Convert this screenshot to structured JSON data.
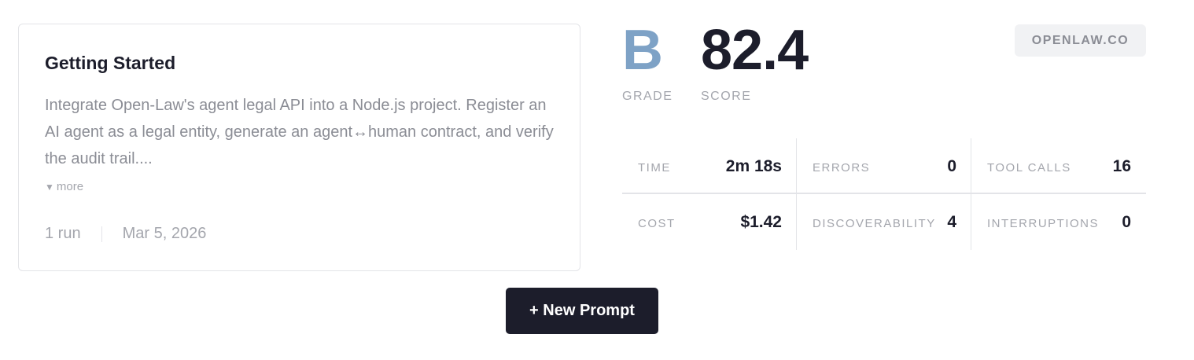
{
  "prompt_card": {
    "title": "Getting Started",
    "description": "Integrate Open-Law's agent legal API into a Node.js project. Register an AI agent as a legal entity, generate an agent↔human contract, and verify the audit trail....",
    "more_icon": "▼",
    "more_label": "more",
    "runs": "1 run",
    "date": "Mar 5, 2026"
  },
  "result": {
    "grade": "B",
    "grade_label": "GRADE",
    "score": "82.4",
    "score_label": "SCORE",
    "domain": "OPENLAW.CO"
  },
  "stats": [
    {
      "label": "TIME",
      "value": "2m 18s"
    },
    {
      "label": "ERRORS",
      "value": "0"
    },
    {
      "label": "TOOL CALLS",
      "value": "16"
    },
    {
      "label": "COST",
      "value": "$1.42"
    },
    {
      "label": "DISCOVERABILITY",
      "value": "4"
    },
    {
      "label": "INTERRUPTIONS",
      "value": "0"
    }
  ],
  "actions": {
    "new_prompt": "+ New Prompt"
  },
  "colors": {
    "grade": "#7ea2c6",
    "primary_button": "#1c1d2b",
    "muted_text": "#a4a6ad"
  }
}
